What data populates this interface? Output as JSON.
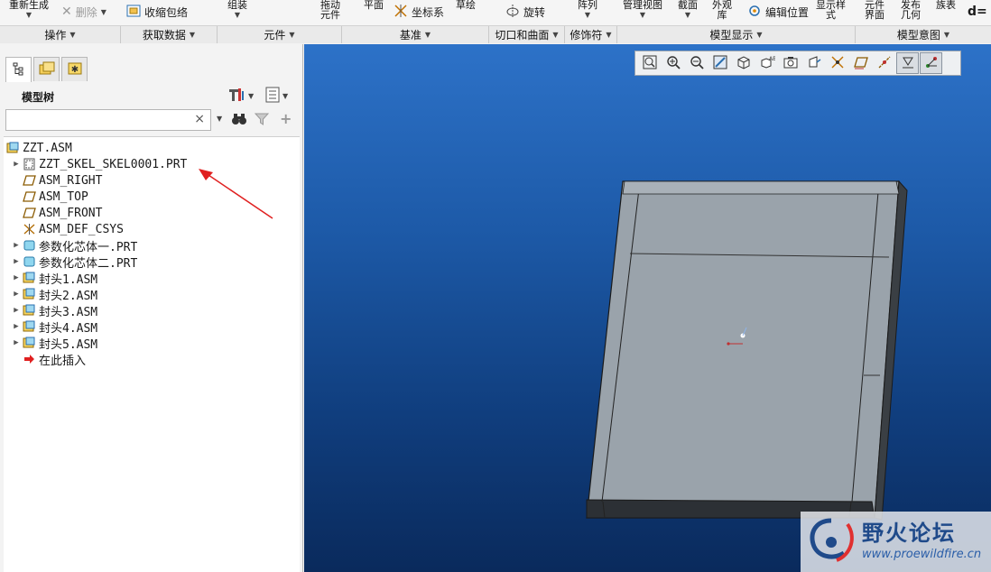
{
  "ribbon": {
    "regenerate": "重新生成",
    "delete": "删除",
    "shrinkwrap": "收缩包络",
    "assemble": "组装",
    "drag_components_1": "拖动",
    "drag_components_2": "元件",
    "plane": "平面",
    "coord_system": "坐标系",
    "sketch": "草绘",
    "revolve": "旋转",
    "pattern": "阵列",
    "manage_views": "管理视图",
    "section": "截面",
    "appearance_1": "外观",
    "appearance_2": "库",
    "edit_position": "编辑位置",
    "display_style_1": "显示样",
    "display_style_2": "式",
    "component_interface_1": "元件",
    "component_interface_2": "界面",
    "publish_geometry_1": "发布",
    "publish_geometry_2": "几何",
    "family_table": "族表",
    "d_symbol": "d="
  },
  "groups": {
    "operations": "操作",
    "get_data": "获取数据",
    "component": "元件",
    "datum": "基准",
    "cut_surface": "切口和曲面",
    "modifiers": "修饰符",
    "model_display": "模型显示",
    "model_intent": "模型意图"
  },
  "tree": {
    "title": "模型树",
    "search_placeholder": "",
    "clear": "×",
    "items": [
      {
        "label": "ZZT.ASM"
      },
      {
        "label": "ZZT_SKEL_SKEL0001.PRT"
      },
      {
        "label": "ASM_RIGHT"
      },
      {
        "label": "ASM_TOP"
      },
      {
        "label": "ASM_FRONT"
      },
      {
        "label": "ASM_DEF_CSYS"
      },
      {
        "label": "参数化芯体一.PRT"
      },
      {
        "label": "参数化芯体二.PRT"
      },
      {
        "label": "封头1.ASM"
      },
      {
        "label": "封头2.ASM"
      },
      {
        "label": "封头3.ASM"
      },
      {
        "label": "封头4.ASM"
      },
      {
        "label": "封头5.ASM"
      },
      {
        "label": "在此插入"
      }
    ]
  },
  "watermark": {
    "title": "野火论坛",
    "url": "www.proewildfire.cn"
  },
  "colors": {
    "viewport_top": "#2d72c8",
    "viewport_bottom": "#0a2a5c",
    "model_face": "#9aa3ab",
    "arrow": "#e02020"
  }
}
